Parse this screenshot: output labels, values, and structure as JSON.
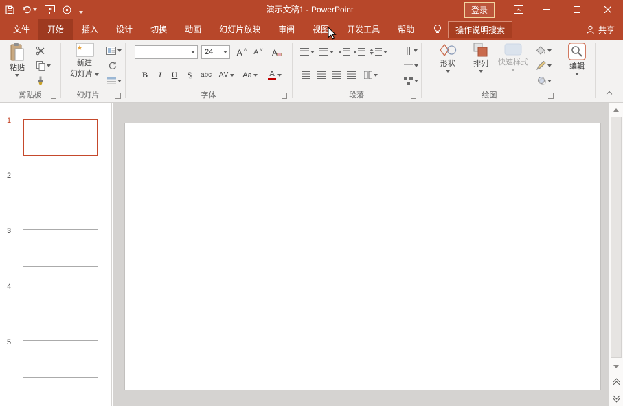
{
  "titlebar": {
    "title": "演示文稿1 - PowerPoint",
    "sign_in": "登录"
  },
  "tabs": {
    "file": "文件",
    "home": "开始",
    "insert": "插入",
    "design": "设计",
    "transitions": "切换",
    "animations": "动画",
    "slide_show": "幻灯片放映",
    "review": "审阅",
    "view": "视图",
    "developer": "开发工具",
    "help": "帮助",
    "search": "操作说明搜索",
    "share": "共享"
  },
  "ribbon": {
    "clipboard": {
      "label": "剪贴板",
      "paste": "粘贴"
    },
    "slides": {
      "label": "幻灯片",
      "new_slide_top": "新建",
      "new_slide_bottom": "幻灯片"
    },
    "font": {
      "label": "字体",
      "size_value": "24",
      "bold": "B",
      "italic": "I",
      "underline": "U",
      "shadow": "S",
      "strikethrough": "abc",
      "char_spacing": "AV",
      "change_case": "Aa",
      "grow": "A",
      "shrink": "A",
      "clear": "A",
      "color": "A"
    },
    "paragraph": {
      "label": "段落"
    },
    "drawing": {
      "label": "绘图",
      "shapes": "形状",
      "arrange": "排列",
      "quick_styles": "快速样式"
    },
    "editing": {
      "label": "编辑"
    }
  },
  "slides_panel": {
    "numbers": [
      "1",
      "2",
      "3",
      "4",
      "5"
    ]
  },
  "colors": {
    "accent": "#B7472A",
    "active_tab": "#9E3A20",
    "selection_border": "#C5492C"
  }
}
